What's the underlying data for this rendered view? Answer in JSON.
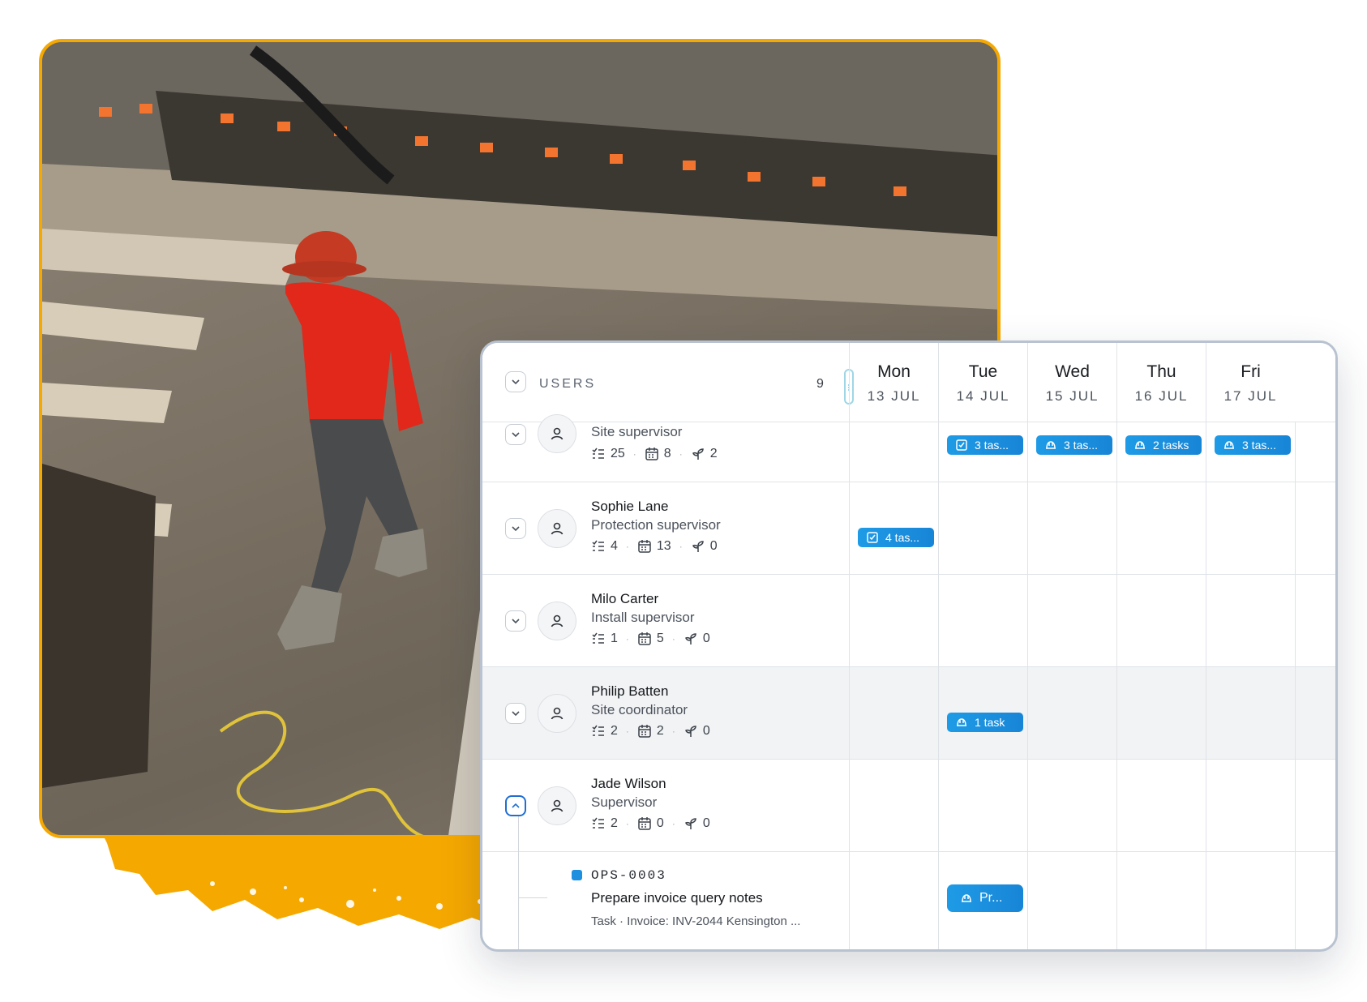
{
  "scheduler": {
    "users_header": {
      "label": "USERS",
      "count": "9"
    },
    "days": [
      {
        "name": "Mon",
        "date": "13 JUL"
      },
      {
        "name": "Tue",
        "date": "14 JUL"
      },
      {
        "name": "Wed",
        "date": "15 JUL"
      },
      {
        "name": "Thu",
        "date": "16 JUL"
      },
      {
        "name": "Fri",
        "date": "17 JUL"
      }
    ],
    "users": [
      {
        "name": "",
        "role": "Site supervisor",
        "tasks": "25",
        "bookings": "8",
        "projects": "2"
      },
      {
        "name": "Sophie Lane",
        "role": "Protection supervisor",
        "tasks": "4",
        "bookings": "13",
        "projects": "0"
      },
      {
        "name": "Milo Carter",
        "role": "Install supervisor",
        "tasks": "1",
        "bookings": "5",
        "projects": "0"
      },
      {
        "name": "Philip Batten",
        "role": "Site coordinator",
        "tasks": "2",
        "bookings": "2",
        "projects": "0"
      },
      {
        "name": "Jade Wilson",
        "role": "Supervisor",
        "tasks": "2",
        "bookings": "0",
        "projects": "0"
      }
    ],
    "pills": {
      "u0_tue": {
        "label": "3 tas...",
        "icon": "checkbox-icon"
      },
      "u0_wed": {
        "label": "3 tas...",
        "icon": "hard-hat-icon"
      },
      "u0_thu": {
        "label": "2 tasks",
        "icon": "hard-hat-icon"
      },
      "u0_fri": {
        "label": "3 tas...",
        "icon": "hard-hat-icon"
      },
      "u1_mon": {
        "label": "4 tas...",
        "icon": "checkbox-icon"
      },
      "u3_tue": {
        "label": "1 task",
        "icon": "hard-hat-icon"
      },
      "task_tue": {
        "label": "Pr...",
        "icon": "hard-hat-icon"
      }
    },
    "subtask": {
      "code": "OPS-0003",
      "title": "Prepare invoice query notes",
      "meta": "Task · Invoice: INV-2044 Kensington ..."
    }
  },
  "colors": {
    "accent_orange": "#f5a800",
    "pill_blue": "#1e9be6",
    "active_outline": "#1f6fd1"
  }
}
